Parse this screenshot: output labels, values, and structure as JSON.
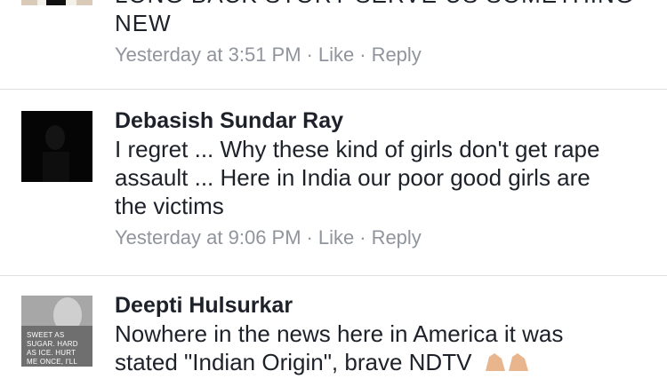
{
  "comments": [
    {
      "author": "",
      "text": "LONG BACK STORY SERVE US SOMETHING NEW",
      "time": "Yesterday at 3:51 PM",
      "like": "Like",
      "reply": "Reply"
    },
    {
      "author": "Debasish Sundar Ray",
      "text": "I regret ... Why these kind of girls don't get rape assault ... Here in India our poor good girls are the victims",
      "time": "Yesterday at 9:06 PM",
      "like": "Like",
      "reply": "Reply"
    },
    {
      "author": "Deepti Hulsurkar",
      "text": "Nowhere in the news here in America it was stated \"Indian Origin\", brave NDTV",
      "avatar_text": "SWEET AS SUGAR. HARD AS ICE. HURT ME ONCE, I'LL KILL YOU TWICE.",
      "emoji": "clapping-hands-icon"
    }
  ],
  "separator": "·"
}
